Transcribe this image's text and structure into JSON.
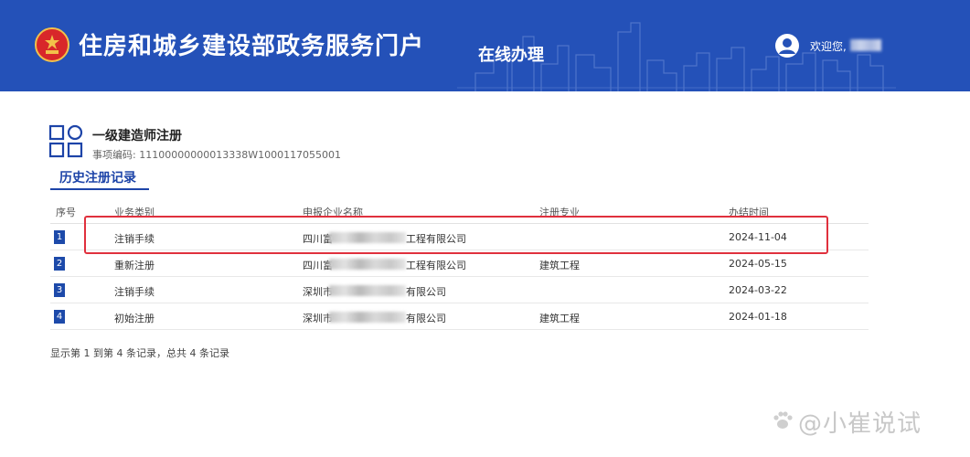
{
  "header": {
    "site_title": "住房和城乡建设部政务服务门户",
    "section": "在线办理",
    "welcome": "欢迎您,",
    "bg_color": "#2451b8"
  },
  "item": {
    "title": "一级建造师注册",
    "code_label": "事项编码:",
    "code_value": "11100000000013338W1000117055001",
    "icon": "grid-apps-icon"
  },
  "tab": {
    "label": "历史注册记录"
  },
  "table": {
    "headers": [
      "序号",
      "业务类别",
      "申报企业名称",
      "注册专业",
      "办结时间"
    ],
    "rows": [
      {
        "index": "1",
        "type": "注销手续",
        "company_prefix": "四川富",
        "company_suffix": "工程有限公司",
        "major": "",
        "date": "2024-11-04"
      },
      {
        "index": "2",
        "type": "重新注册",
        "company_prefix": "四川富",
        "company_suffix": "工程有限公司",
        "major": "建筑工程",
        "date": "2024-05-15"
      },
      {
        "index": "3",
        "type": "注销手续",
        "company_prefix": "深圳市",
        "company_suffix": "有限公司",
        "major": "",
        "date": "2024-03-22"
      },
      {
        "index": "4",
        "type": "初始注册",
        "company_prefix": "深圳市",
        "company_suffix": "有限公司",
        "major": "建筑工程",
        "date": "2024-01-18"
      }
    ]
  },
  "pager": {
    "text": "显示第 1 到第 4 条记录，总共 4 条记录"
  },
  "watermark": {
    "text": "@小崔说试"
  },
  "colors": {
    "accent": "#1d44a8",
    "highlight": "#e0303d"
  }
}
